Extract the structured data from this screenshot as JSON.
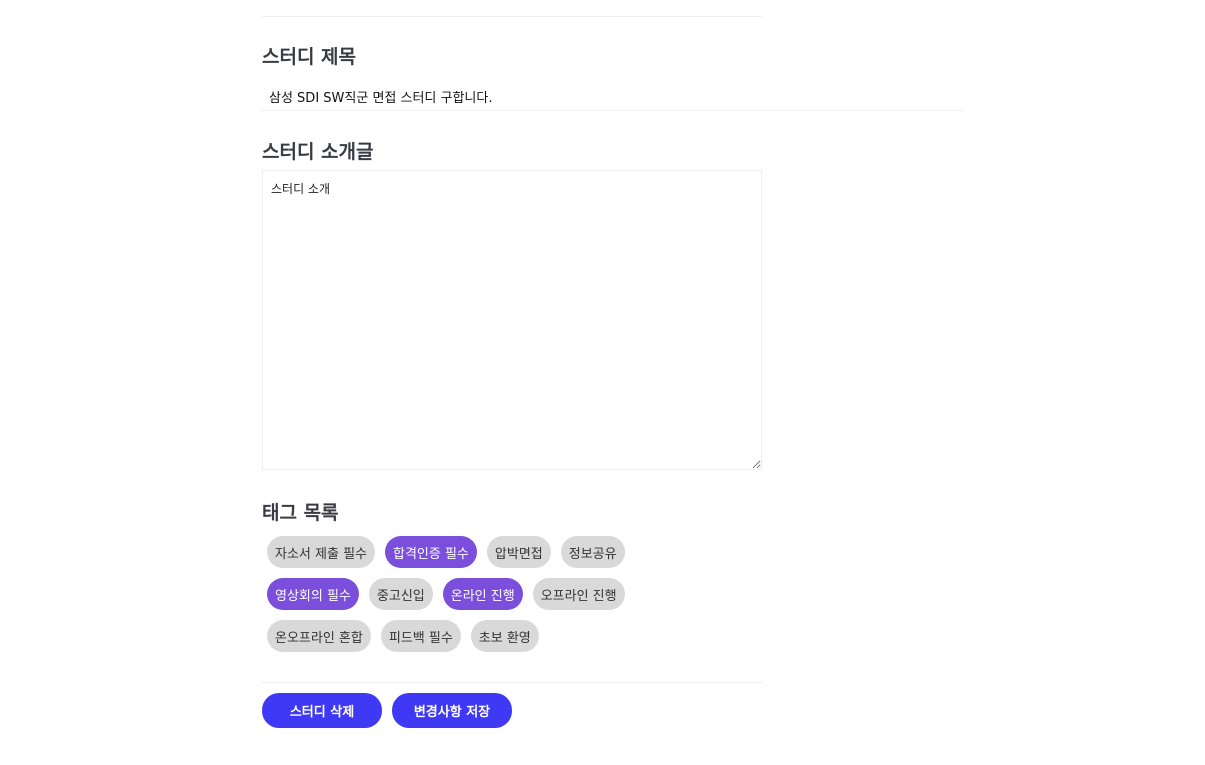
{
  "title_section": {
    "heading": "스터디 제목",
    "value": "삼성 SDI SW직군 면접 스터디 구합니다."
  },
  "intro_section": {
    "heading": "스터디 소개글",
    "value": "스터디 소개"
  },
  "tags_section": {
    "heading": "태그 목록",
    "tags": [
      {
        "label": "자소서 제출 필수",
        "selected": false
      },
      {
        "label": "합격인증 필수",
        "selected": true
      },
      {
        "label": "압박면접",
        "selected": false
      },
      {
        "label": "정보공유",
        "selected": false
      },
      {
        "label": "영상회의 필수",
        "selected": true
      },
      {
        "label": "중고신입",
        "selected": false
      },
      {
        "label": "온라인 진행",
        "selected": true
      },
      {
        "label": "오프라인 진행",
        "selected": false
      },
      {
        "label": "온오프라인 혼합",
        "selected": false
      },
      {
        "label": "피드백 필수",
        "selected": false
      },
      {
        "label": "초보 환영",
        "selected": false
      }
    ]
  },
  "actions": {
    "delete_label": "스터디 삭제",
    "save_label": "변경사항 저장"
  },
  "colors": {
    "tag_selected": "#7b4fdc",
    "tag_unselected": "#d9d9d9",
    "button": "#3f39f5"
  }
}
